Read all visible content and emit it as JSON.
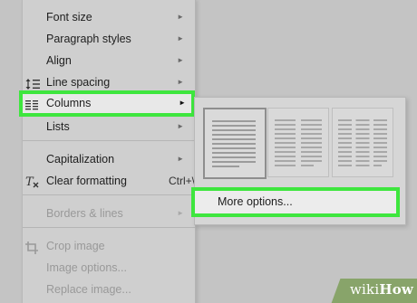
{
  "menu": {
    "items": [
      {
        "label": "Font size",
        "arrow": "►"
      },
      {
        "label": "Paragraph styles",
        "arrow": "►"
      },
      {
        "label": "Align",
        "arrow": "►"
      },
      {
        "label": "Line spacing",
        "arrow": "►",
        "icon": "line-spacing-icon"
      },
      {
        "label": "Columns",
        "arrow": "►",
        "icon": "columns-icon",
        "state": "highlighted"
      },
      {
        "label": "Lists",
        "arrow": "►"
      },
      {
        "label": "Capitalization",
        "arrow": "►"
      },
      {
        "label": "Clear formatting",
        "shortcut": "Ctrl+\\",
        "icon": "clear-formatting-icon"
      },
      {
        "label": "Borders & lines",
        "arrow": "►",
        "state": "disabled"
      },
      {
        "label": "Crop image",
        "icon": "crop-icon",
        "state": "disabled"
      },
      {
        "label": "Image options...",
        "state": "disabled"
      },
      {
        "label": "Replace image...",
        "state": "disabled"
      }
    ]
  },
  "columns_submenu": {
    "presets": [
      {
        "columns": 1,
        "selected": true
      },
      {
        "columns": 2,
        "selected": false
      },
      {
        "columns": 3,
        "selected": false
      }
    ],
    "more_options_label": "More options..."
  },
  "watermark": {
    "part1": "wiki",
    "part2": "How"
  },
  "colors": {
    "highlight_outline": "#3ee63e",
    "menu_background": "#cfcfcf",
    "badge": "#88a46a"
  }
}
